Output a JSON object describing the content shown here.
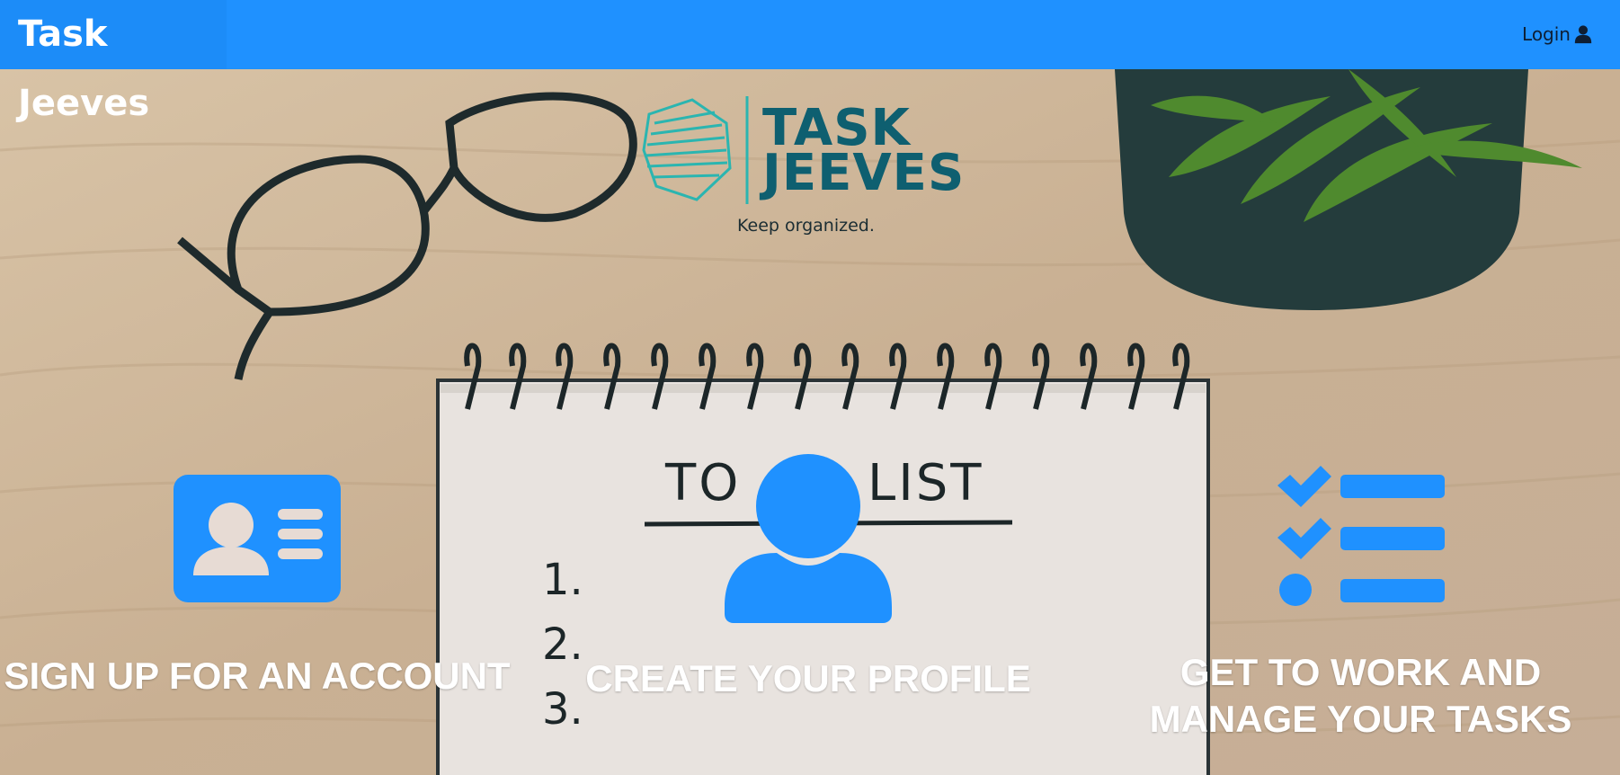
{
  "header": {
    "brand": "Task Jeeves",
    "login_label": "Login"
  },
  "logo": {
    "word_1": "TASK",
    "word_2": "JEEVES",
    "tagline": "Keep organized."
  },
  "notebook": {
    "title_left": "TO",
    "title_right": "LIST",
    "items": [
      "1.",
      "2.",
      "3."
    ]
  },
  "steps": [
    {
      "caption": "SIGN UP FOR AN ACCOUNT",
      "icon": "id-card-icon"
    },
    {
      "caption": "CREATE YOUR PROFILE",
      "icon": "user-icon"
    },
    {
      "caption": "GET TO WORK AND MANAGE YOUR TASKS",
      "icon": "task-list-icon"
    }
  ],
  "colors": {
    "accent": "#1f91ff",
    "header_bg": "#1f91ff",
    "caption_text": "#ffffff"
  }
}
